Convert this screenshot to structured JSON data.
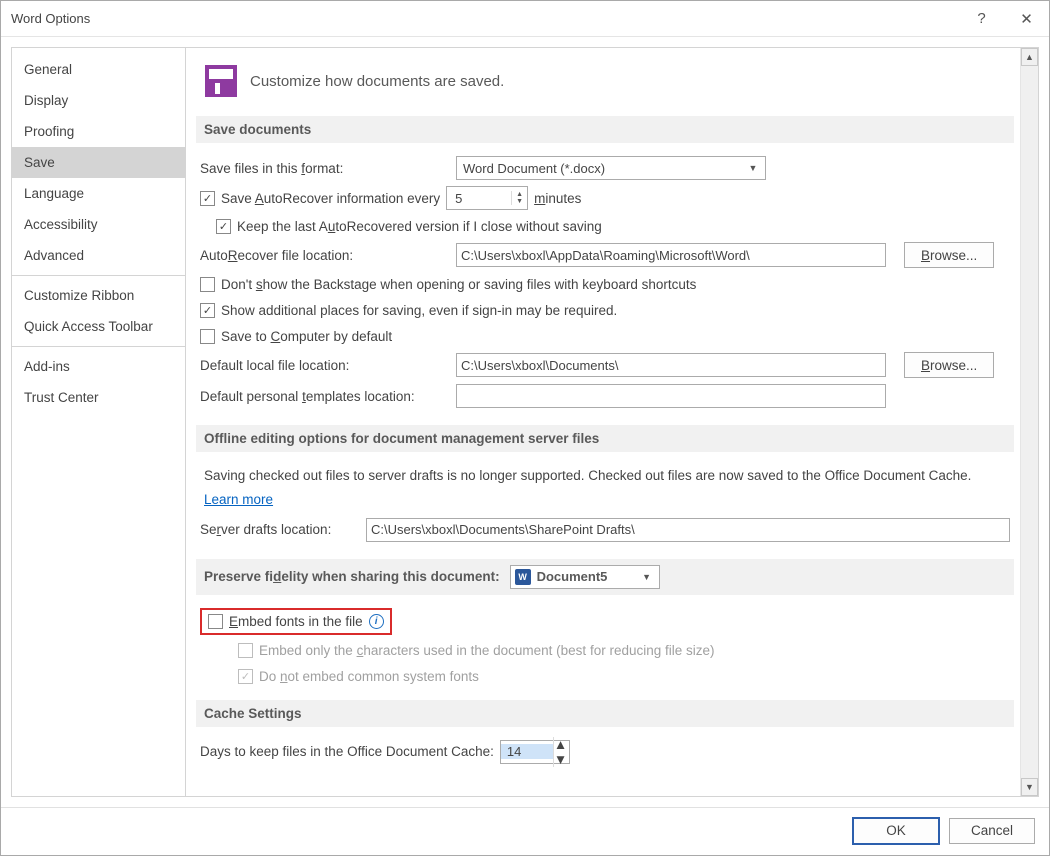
{
  "title": "Word Options",
  "titlebar": {
    "help": "?",
    "close": "✕"
  },
  "sidebar": {
    "items": [
      {
        "label": "General"
      },
      {
        "label": "Display"
      },
      {
        "label": "Proofing"
      },
      {
        "label": "Save",
        "selected": true
      },
      {
        "label": "Language"
      },
      {
        "label": "Accessibility"
      },
      {
        "label": "Advanced"
      }
    ],
    "group2": [
      {
        "label": "Customize Ribbon"
      },
      {
        "label": "Quick Access Toolbar"
      }
    ],
    "group3": [
      {
        "label": "Add-ins"
      },
      {
        "label": "Trust Center"
      }
    ]
  },
  "header": "Customize how documents are saved.",
  "section_save_documents": "Save documents",
  "save_format": {
    "label_pre": "Save files in this ",
    "label_u": "f",
    "label_post": "ormat:",
    "value": "Word Document (*.docx)"
  },
  "autorecover": {
    "pre": "Save ",
    "u": "A",
    "post": "utoRecover information every",
    "value": "5",
    "minutes_u": "m",
    "minutes_post": "inutes"
  },
  "keep_last": {
    "pre": "Keep the last A",
    "u": "u",
    "post": "toRecovered version if I close without saving"
  },
  "autorecover_loc": {
    "label_pre": "Auto",
    "label_u": "R",
    "label_post": "ecover file location:",
    "value": "C:\\Users\\xboxl\\AppData\\Roaming\\Microsoft\\Word\\",
    "browse_u": "B",
    "browse_post": "rowse..."
  },
  "dont_show_backstage": {
    "pre": "Don't ",
    "u": "s",
    "post": "how the Backstage when opening or saving files with keyboard shortcuts"
  },
  "show_additional": "Show additional places for saving, even if sign-in may be required.",
  "save_to_computer": {
    "pre": "Save to ",
    "u": "C",
    "post": "omputer by default"
  },
  "default_local": {
    "label": "Default local file location:",
    "value": "C:\\Users\\xboxl\\Documents\\",
    "browse_u": "B",
    "browse_post": "rowse..."
  },
  "default_personal": {
    "label_pre": "Default personal ",
    "label_u": "t",
    "label_post": "emplates location:"
  },
  "section_offline": "Offline editing options for document management server files",
  "offline_para": "Saving checked out files to server drafts is no longer supported. Checked out files are now saved to the Office Document Cache.",
  "learn_more": "Learn more",
  "server_drafts": {
    "label_pre": "Se",
    "label_u": "r",
    "label_post": "ver drafts location:",
    "value": "C:\\Users\\xboxl\\Documents\\SharePoint Drafts\\"
  },
  "section_preserve": {
    "pre": "Preserve fi",
    "u": "d",
    "post": "elity when sharing this document:",
    "doc": "Document5"
  },
  "embed_fonts": {
    "u": "E",
    "post": "mbed fonts in the file"
  },
  "embed_only": {
    "pre": "Embed only the ",
    "u": "c",
    "post": "haracters used in the document (best for reducing file size)"
  },
  "do_not_embed": {
    "pre": "Do ",
    "u": "n",
    "post": "ot embed common system fonts"
  },
  "section_cache": "Cache Settings",
  "cache_days": {
    "label": "Days to keep files in the Office Document Cache:",
    "value": "14"
  },
  "footer": {
    "ok": "OK",
    "cancel": "Cancel"
  }
}
